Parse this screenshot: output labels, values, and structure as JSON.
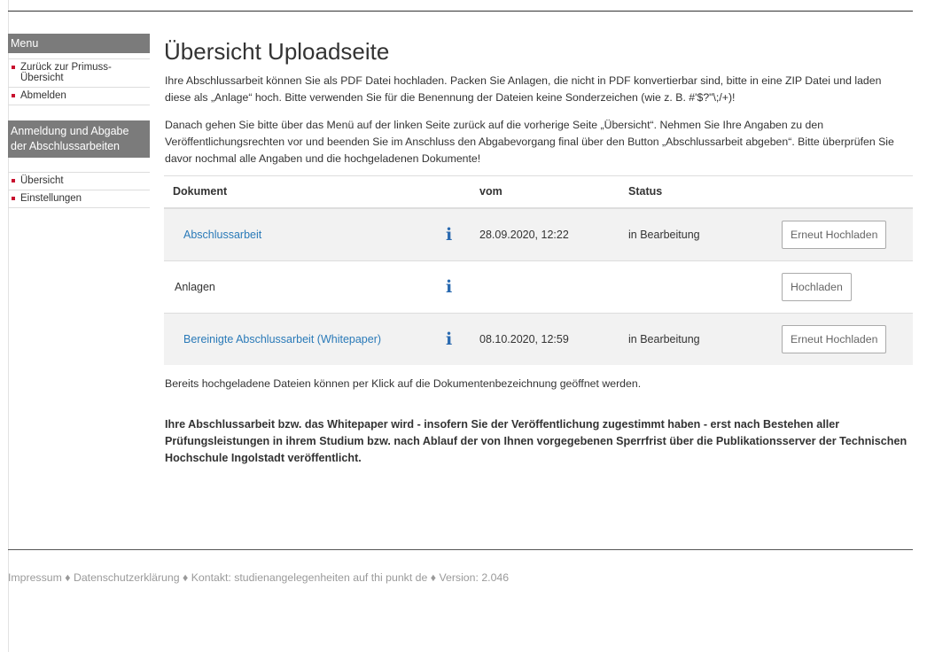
{
  "sidebar": {
    "menu_heading": "Menu",
    "menu_items": [
      {
        "label": "Zurück zur Primuss-Übersicht"
      },
      {
        "label": "Abmelden"
      }
    ],
    "section_heading": "Anmeldung und Abgabe der Abschlussarbeiten",
    "section_items": [
      {
        "label": "Übersicht"
      },
      {
        "label": "Einstellungen"
      }
    ]
  },
  "main": {
    "title": "Übersicht Uploadseite",
    "para1": "Ihre Abschlussarbeit können Sie als PDF Datei hochladen. Packen Sie Anlagen, die nicht in PDF konvertierbar sind, bitte in eine ZIP Datei und laden diese als „Anlage“ hoch. Bitte verwenden Sie für die Benennung der Dateien keine Sonderzeichen (wie z. B. #'$?\"\\;/+)!",
    "para2": "Danach gehen Sie bitte über das Menü auf der linken Seite zurück auf die vorherige Seite „Übersicht“. Nehmen Sie Ihre Angaben zu den Veröffentlichungsrechten vor und beenden Sie im Anschluss den Abgabevorgang final über den Button „Abschlussarbeit abgeben“. Bitte überprüfen Sie davor nochmal alle Angaben und die hochgeladenen Dokumente!",
    "table": {
      "headers": {
        "document": "Dokument",
        "date": "vom",
        "status": "Status"
      },
      "rows": [
        {
          "document": "Abschlussarbeit",
          "info_icon": "i",
          "date": "28.09.2020, 12:22",
          "status": "in Bearbeitung",
          "button": "Erneut Hochladen"
        },
        {
          "document": "Anlagen",
          "info_icon": "i",
          "date": "",
          "status": "",
          "button": "Hochladen"
        },
        {
          "document": "Bereinigte Abschlussarbeit (Whitepaper)",
          "info_icon": "i",
          "date": "08.10.2020, 12:59",
          "status": "in Bearbeitung",
          "button": "Erneut Hochladen"
        }
      ]
    },
    "note": "Bereits hochgeladene Dateien können per Klick auf die Dokumentenbezeichnung geöffnet werden.",
    "bold_note": "Ihre Abschlussarbeit bzw. das Whitepaper wird - insofern Sie der Veröffentlichung zugestimmt haben - erst nach Bestehen aller Prüfungsleistungen in ihrem Studium bzw. nach Ablauf der von Ihnen vorgegebenen Sperrfrist über die Publikationsserver der Technischen Hochschule Ingolstadt veröffentlicht."
  },
  "footer": {
    "impressum": "Impressum",
    "privacy": "Datenschutzerklärung",
    "contact": "Kontakt: studienangelegenheiten auf thi punkt de",
    "version": "Version: 2.046",
    "separator": "♦"
  },
  "colors": {
    "accent_bullet": "#c8102e",
    "link": "#2a7ab8",
    "sidebar_heading_bg": "#7b7b7b"
  }
}
